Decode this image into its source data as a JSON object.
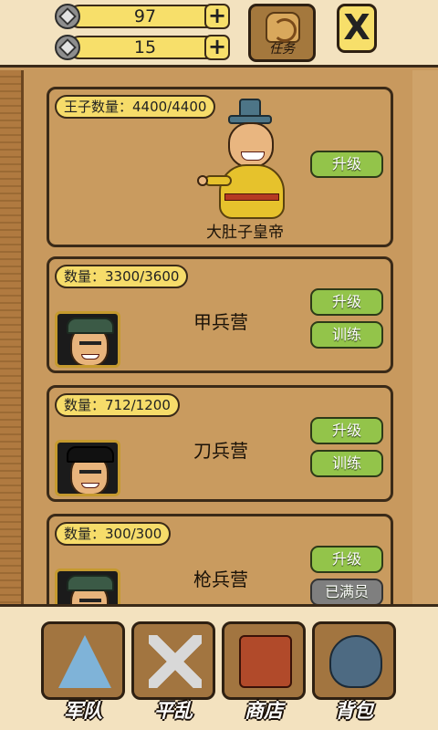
{
  "currencies": [
    {
      "value": "97",
      "plus": "+"
    },
    {
      "value": "15",
      "plus": "+"
    }
  ],
  "quest_button": {
    "label": "任务"
  },
  "close_button": {
    "label": "X"
  },
  "cards": [
    {
      "count": "王子数量：4400/4400",
      "name": "大肚子皇帝",
      "buttons": [
        "升级"
      ]
    },
    {
      "count": "数量：3300/3600",
      "name": "甲兵营",
      "buttons": [
        "升级",
        "训练"
      ]
    },
    {
      "count": "数量：712/1200",
      "name": "刀兵营",
      "buttons": [
        "升级",
        "训练"
      ]
    },
    {
      "count": "数量：300/300",
      "name": "枪兵营",
      "buttons": [
        "升级",
        "已满员"
      ]
    }
  ],
  "nav": [
    {
      "label": "军队",
      "icon": "tent-icon"
    },
    {
      "label": "平乱",
      "icon": "crossed-swords-icon"
    },
    {
      "label": "商店",
      "icon": "shop-icon"
    },
    {
      "label": "背包",
      "icon": "bag-icon"
    }
  ]
}
